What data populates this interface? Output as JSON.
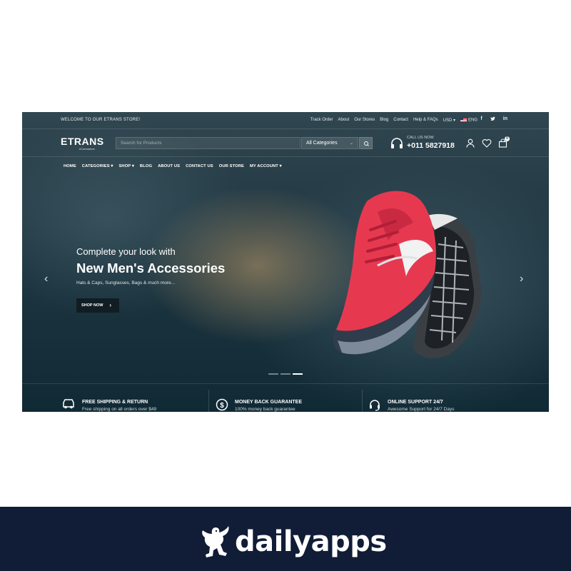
{
  "topbar": {
    "welcome": "WELCOME TO OUR ETRANS STORE!",
    "links": [
      "Track Order",
      "About",
      "Our Stores",
      "Blog",
      "Contact",
      "Help & FAQs"
    ],
    "currency": "USD",
    "language": "ENG",
    "social": [
      "f",
      "t",
      "in"
    ]
  },
  "header": {
    "logo_name": "ETRANS",
    "logo_tag": "eCommerce",
    "search_placeholder": "Search for Products",
    "category_select": "All Categories",
    "call_label": "CALL US NOW",
    "call_number": "+011 5827918",
    "cart_count": "0"
  },
  "nav": {
    "items": [
      "HOME",
      "CATEGORIES",
      "SHOP",
      "BLOG",
      "ABOUT US",
      "CONTACT US",
      "OUR STORE",
      "MY ACCOUNT"
    ]
  },
  "hero": {
    "kicker": "Complete your look with",
    "title": "New Men's Accessories",
    "subtitle": "Hats & Caps, Sunglasses, Bags & much more...",
    "cta": "SHOP NOW",
    "slides": 3,
    "active_slide": 3
  },
  "features": [
    {
      "title": "FREE SHIPPING & RETURN",
      "desc": "Free shipping on all orders over $49",
      "icon": "truck-icon"
    },
    {
      "title": "MONEY BACK GUARANTEE",
      "desc": "100% money back guarantee",
      "icon": "dollar-coin-icon"
    },
    {
      "title": "ONLINE SUPPORT 24/7",
      "desc": "Awesome Support for 24/7 Days",
      "icon": "headset-icon"
    }
  ],
  "brand": {
    "name": "dailyapps"
  },
  "colors": {
    "brand_bar": "#111c36",
    "accent_shoe": "#e63950"
  }
}
